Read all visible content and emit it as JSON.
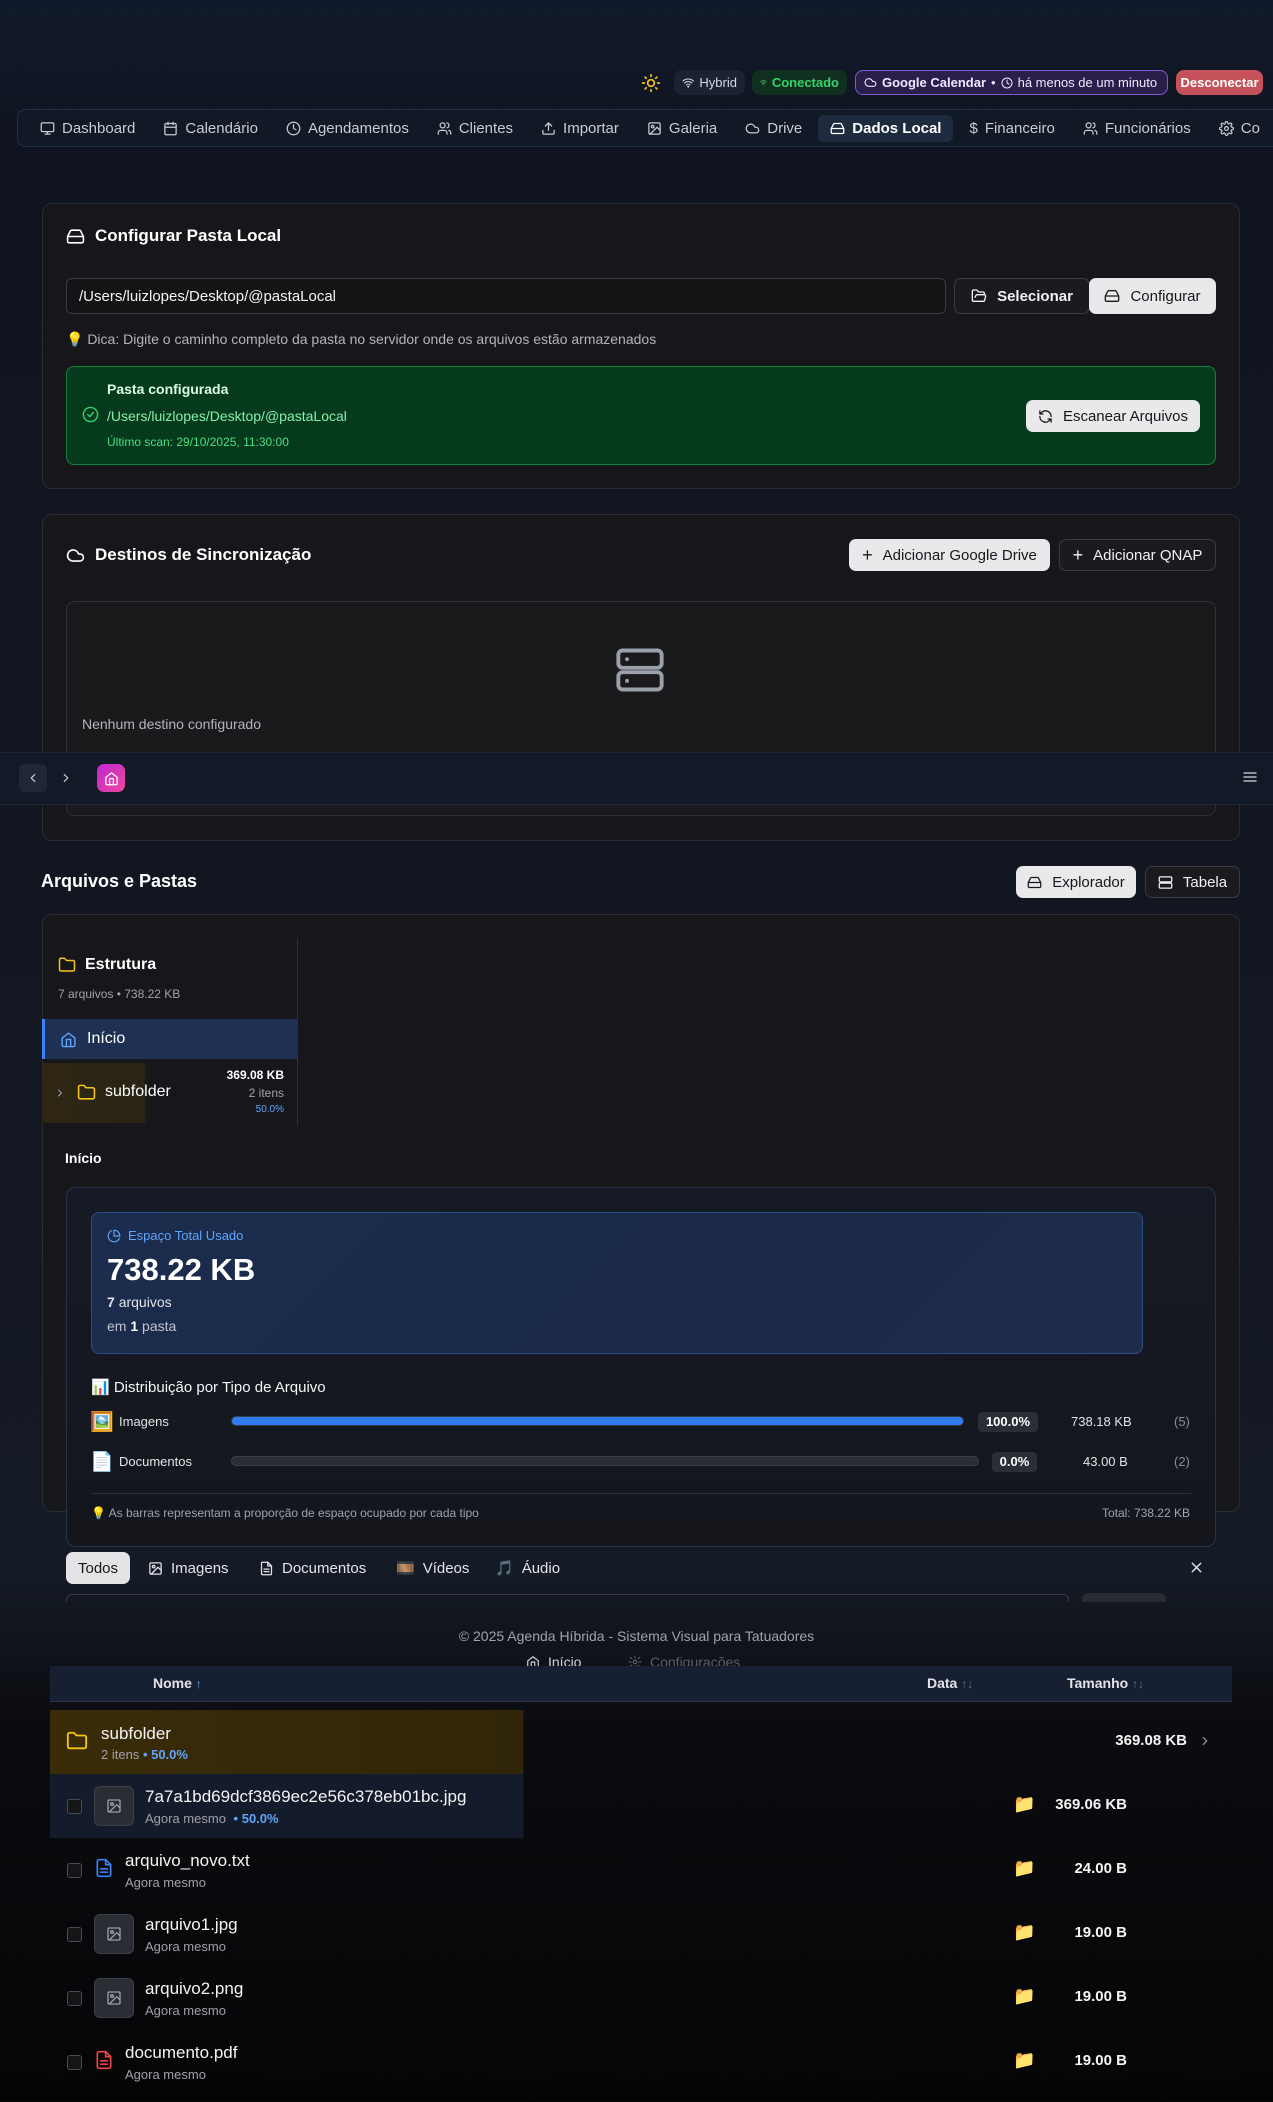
{
  "status": {
    "hybrid": "Hybrid",
    "connected": "Conectado",
    "calendar": "Google Calendar",
    "calendar_time": "há menos de um minuto",
    "disconnect": "Desconectar"
  },
  "nav": [
    "Dashboard",
    "Calendário",
    "Agendamentos",
    "Clientes",
    "Importar",
    "Galeria",
    "Drive",
    "Dados Local",
    "Financeiro",
    "Funcionários",
    "Co"
  ],
  "config": {
    "title": "Configurar Pasta Local",
    "path_value": "/Users/luizlopes/Desktop/@pastaLocal",
    "select_btn": "Selecionar",
    "configure_btn": "Configurar",
    "tip": "💡 Dica: Digite o caminho completo da pasta no servidor onde os arquivos estão armazenados",
    "configured_title": "Pasta configurada",
    "configured_path": "/Users/luizlopes/Desktop/@pastaLocal",
    "last_scan": "Último scan: 29/10/2025, 11:30:00",
    "scan_btn": "Escanear Arquivos"
  },
  "sync": {
    "title": "Destinos de Sincronização",
    "add_drive": "Adicionar Google Drive",
    "add_qnap": "Adicionar QNAP",
    "empty": "Nenhum destino configurado"
  },
  "files": {
    "title": "Arquivos e Pastas",
    "explorer_btn": "Explorador",
    "table_btn": "Tabela",
    "tree_title": "Estrutura",
    "tree_meta": "7 arquivos • 738.22 KB",
    "tree_home": "Início",
    "tree_sub": "subfolder",
    "tree_sub_size": "369.08 KB",
    "tree_sub_items": "2 itens",
    "tree_sub_pct": "50.0%",
    "crumb": "Início"
  },
  "usage": {
    "label": "Espaço Total Usado",
    "total": "738.22 KB",
    "files_count": "7",
    "files_word": "arquivos",
    "folders_prefix": "em",
    "folders_count": "1",
    "folders_word": "pasta",
    "dist_title": "📊 Distribuição por Tipo de Arquivo",
    "types": [
      {
        "icon": "🖼️",
        "name": "Imagens",
        "pct_label": "100.0%",
        "pct": 100,
        "size": "738.18 KB",
        "count": "(5)"
      },
      {
        "icon": "📄",
        "name": "Documentos",
        "pct_label": "0.0%",
        "pct": 0,
        "size": "43.00 B",
        "count": "(2)"
      }
    ],
    "note": "💡 As barras representam a proporção de espaço ocupado por cada tipo",
    "total_note": "Total: 738.22 KB"
  },
  "filters": [
    "Todos",
    "Imagens",
    "Documentos",
    "Vídeos",
    "Áudio"
  ],
  "filter_icons": [
    "",
    "🖼",
    "📄",
    "🎞️",
    "🎵"
  ],
  "footer": {
    "copyright": "© 2025 Agenda Híbrida - Sistema Visual para Tatuadores",
    "home": "Início",
    "settings": "Configurações"
  },
  "table": {
    "col_name": "Nome",
    "col_date": "Data",
    "col_size": "Tamanho",
    "folder": {
      "name": "subfolder",
      "items": "2 itens",
      "pct": "• 50.0%",
      "size": "369.08 KB"
    },
    "rows": [
      {
        "name": "7a7a1bd69dcf3869ec2e56c378eb01bc.jpg",
        "sub": "Agora mesmo",
        "pct": "• 50.0%",
        "size": "369.06 KB",
        "kind": "image"
      },
      {
        "name": "arquivo_novo.txt",
        "sub": "Agora mesmo",
        "pct": "",
        "size": "24.00 B",
        "kind": "text"
      },
      {
        "name": "arquivo1.jpg",
        "sub": "Agora mesmo",
        "pct": "",
        "size": "19.00 B",
        "kind": "image"
      },
      {
        "name": "arquivo2.png",
        "sub": "Agora mesmo",
        "pct": "",
        "size": "19.00 B",
        "kind": "image"
      },
      {
        "name": "documento.pdf",
        "sub": "Agora mesmo",
        "pct": "",
        "size": "19.00 B",
        "kind": "pdf"
      }
    ]
  },
  "colors": {
    "accent": "#2f7cf0",
    "success": "#22c55e",
    "danger": "#c5525b",
    "folder": "#f5c518"
  }
}
